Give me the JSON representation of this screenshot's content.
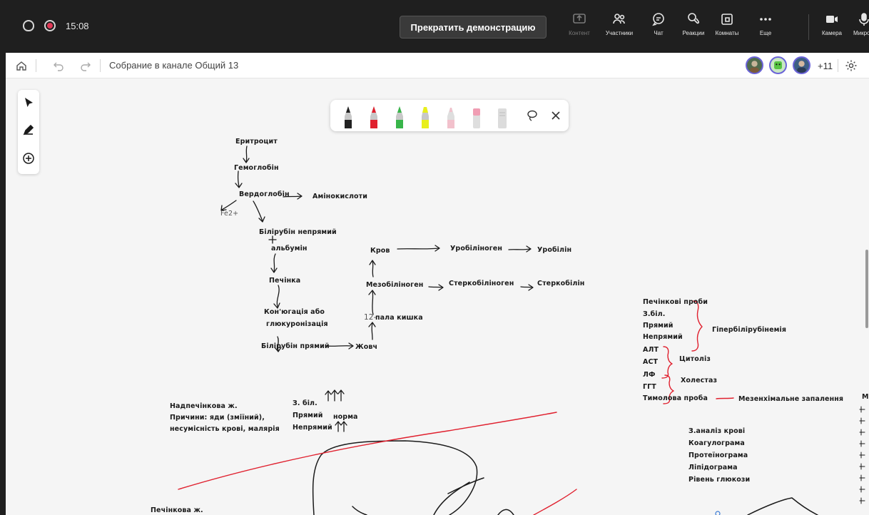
{
  "meeting": {
    "time": "15:08",
    "stop_share_label": "Прекратить демонстрацию",
    "controls": [
      {
        "id": "content",
        "label": "Контент",
        "icon": "share-screen-icon"
      },
      {
        "id": "participants",
        "label": "Участники",
        "icon": "people-icon"
      },
      {
        "id": "chat",
        "label": "Чат",
        "icon": "chat-icon"
      },
      {
        "id": "reactions",
        "label": "Реакции",
        "icon": "hand-icon"
      },
      {
        "id": "rooms",
        "label": "Комнаты",
        "icon": "rooms-icon"
      },
      {
        "id": "more",
        "label": "Еще",
        "icon": "more-icon"
      },
      {
        "id": "camera",
        "label": "Камера",
        "icon": "camera-icon"
      },
      {
        "id": "mic",
        "label": "Микроф",
        "icon": "mic-icon"
      }
    ]
  },
  "whiteboard": {
    "title": "Собрание в канале Общий 13",
    "extra_participants": "+11",
    "pens": [
      {
        "name": "black-pen",
        "color": "#222222"
      },
      {
        "name": "red-pen",
        "color": "#e0202e"
      },
      {
        "name": "green-pen",
        "color": "#38b54a"
      },
      {
        "name": "yellow-highlighter",
        "color": "#e8ef1c"
      },
      {
        "name": "pink-pen",
        "color": "#f2c1cc"
      },
      {
        "name": "pink-highlighter",
        "color": "#f09db3"
      },
      {
        "name": "eraser",
        "color": "#dcdcdc"
      }
    ]
  },
  "notes": {
    "erythrocyte": "Еритроцит",
    "hemoglobin": "Гемоглобін",
    "verdoglobin": "Вердоглобін",
    "amino_acids": "Амінокислоти",
    "fe": "Fe2+",
    "bilirubin_indirect": "Білірубін непрямий",
    "plus": "+",
    "albumin": "альбумін",
    "liver": "Печінка",
    "conjugation_1": "Кон'югація або",
    "conjugation_2": "глюкуронізація",
    "bilirubin_direct": "Білірубін прямий",
    "bile": "Жовч",
    "duodenum_num": "12-",
    "duodenum": "пала кишка",
    "mesobilinogen": "Мезобіліноген",
    "blood": "Кров",
    "urobilinogen": "Уробіліноген",
    "urobilin": "Уробілін",
    "stercobilinogen": "Стеркобіліноген",
    "stercobilin": "Стеркобілін",
    "liver_tests": "Печінкові проби",
    "total_bili": "З.біл.",
    "direct": "Прямий",
    "indirect": "Непрямий",
    "hyperbili": "Гіпербілірубінемія",
    "alt": "АЛТ",
    "ast": "АСТ",
    "cytolysis": "Цитоліз",
    "alp": "ЛФ",
    "ggt": "ГГТ",
    "cholestasis": "Холестаз",
    "thymol": "Тимолова проба",
    "mesench": "Мезенхімальне запалення",
    "prehepatic": "Надпечінкова ж.",
    "causes_1": "Причини: яди (зміїний),",
    "causes_2": "несумісність крові, малярія",
    "t_bili": "З. біл.",
    "t_direct": "Прямий",
    "t_norm": "норма",
    "t_indirect": "Непрямий",
    "blood_test": "З.аналіз крові",
    "coagulogram": "Коагулограма",
    "proteinogram": "Протеїнограма",
    "lipidogram": "Лiпiдограма",
    "glucose": "Рівень глюкози",
    "hepatic": "Печінкова ж.",
    "edge_letter": "М"
  }
}
